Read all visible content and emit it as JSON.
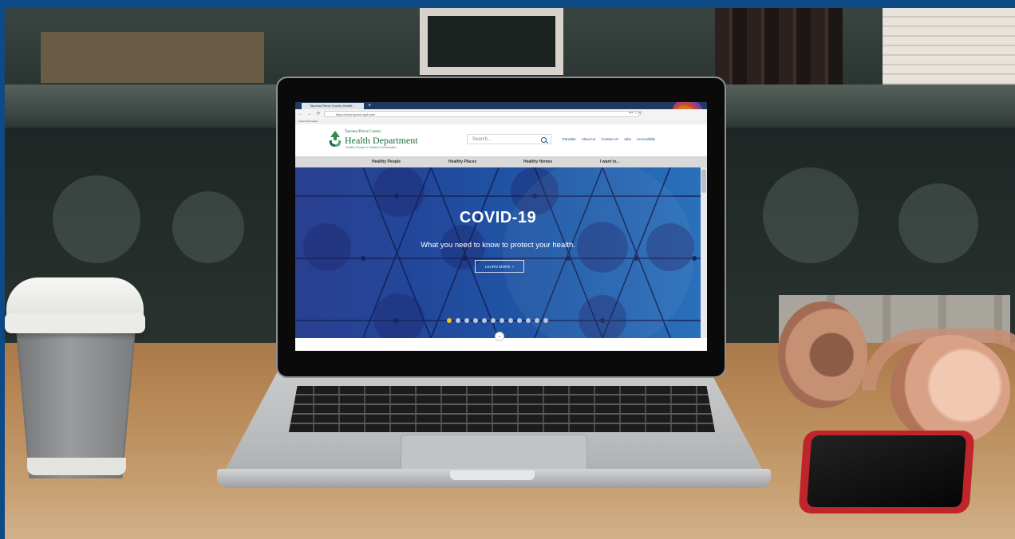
{
  "browser": {
    "tab_title": "Tacoma-Pierce County Health...",
    "new_tab": "+",
    "url": "https://www.tpchd.org/home",
    "nav_icons": "← → ⟳ ⌂",
    "url_right": "••• ☆ ⚲",
    "bookmarks": "Import bookmarks..."
  },
  "site": {
    "logo_small": "Tacoma-Pierce County",
    "logo_main": "Health Department",
    "logo_tagline": "Healthy People in Healthy Communities",
    "search_placeholder": "Search...",
    "util_links": [
      "Translate",
      "About Us",
      "Contact Us",
      "Jobs",
      "Accessibility"
    ],
    "main_nav": [
      "Healthy People",
      "Healthy Places",
      "Healthy Homes",
      "I want to..."
    ]
  },
  "hero": {
    "title": "COVID-19",
    "subtitle": "What you need to know to protect your health.",
    "button": "LEARN MORE »",
    "slide_count": 12,
    "active_slide": 1,
    "scroll_icon": "⌄"
  },
  "colors": {
    "border_blue": "#0d4a86",
    "logo_green": "#1d6a3b",
    "hero_blue": "#22479b",
    "dot_active": "#f2c21b"
  },
  "icons": [
    "search-icon",
    "firefox-logo-icon",
    "chevron-down-icon",
    "health-department-logo-icon"
  ]
}
